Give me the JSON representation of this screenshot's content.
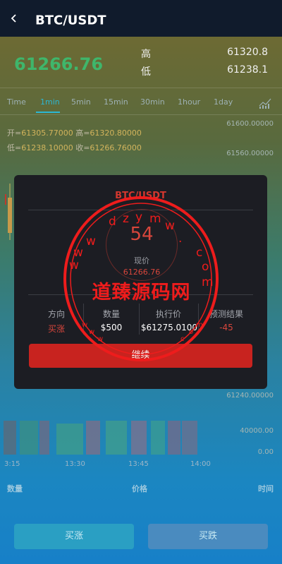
{
  "header": {
    "title": "BTC/USDT"
  },
  "ticker": {
    "price": "61266.76",
    "high_label": "高",
    "high_value": "61320.8",
    "low_label": "低",
    "low_value": "61238.1"
  },
  "tabs": [
    "Time",
    "1min",
    "5min",
    "15min",
    "30min",
    "1hour",
    "1day"
  ],
  "active_tab": "1min",
  "ohlc": {
    "open_label": "开=",
    "open": "61305.77000",
    "high_label": "高=",
    "high": "61320.80000",
    "low_label": "低=",
    "low": "61238.10000",
    "close_label": "收=",
    "close": "61266.76000"
  },
  "chart_data": {
    "type": "candlestick",
    "y_ticks": [
      "61600.00000",
      "61560.00000",
      "61240.00000"
    ],
    "volume_ticks": [
      "40000.00",
      "0.00"
    ],
    "x_ticks": [
      "3:15",
      "13:30",
      "13:45",
      "14:00"
    ]
  },
  "table_headers": {
    "quantity": "数量",
    "price": "价格",
    "time": "时间"
  },
  "buttons": {
    "buy_up": "买涨",
    "buy_down": "买跌"
  },
  "modal": {
    "title": "BTC/USDT",
    "countdown": "54",
    "current_label": "现价",
    "current_price": "61266.76",
    "columns": [
      {
        "header": "方向",
        "value": "买涨"
      },
      {
        "header": "数量",
        "value": "$500"
      },
      {
        "header": "执行价",
        "value": "$61275.0100"
      },
      {
        "header": "预测结果",
        "value": "-45"
      }
    ],
    "continue_label": "继续"
  },
  "watermark": {
    "text": "道臻源码网",
    "ring_text": "dzyw . com www www . com"
  },
  "colors": {
    "up": "#3fb66b",
    "down": "#d8463c",
    "accent": "#2bb7d4",
    "gold": "#d3b45c"
  }
}
